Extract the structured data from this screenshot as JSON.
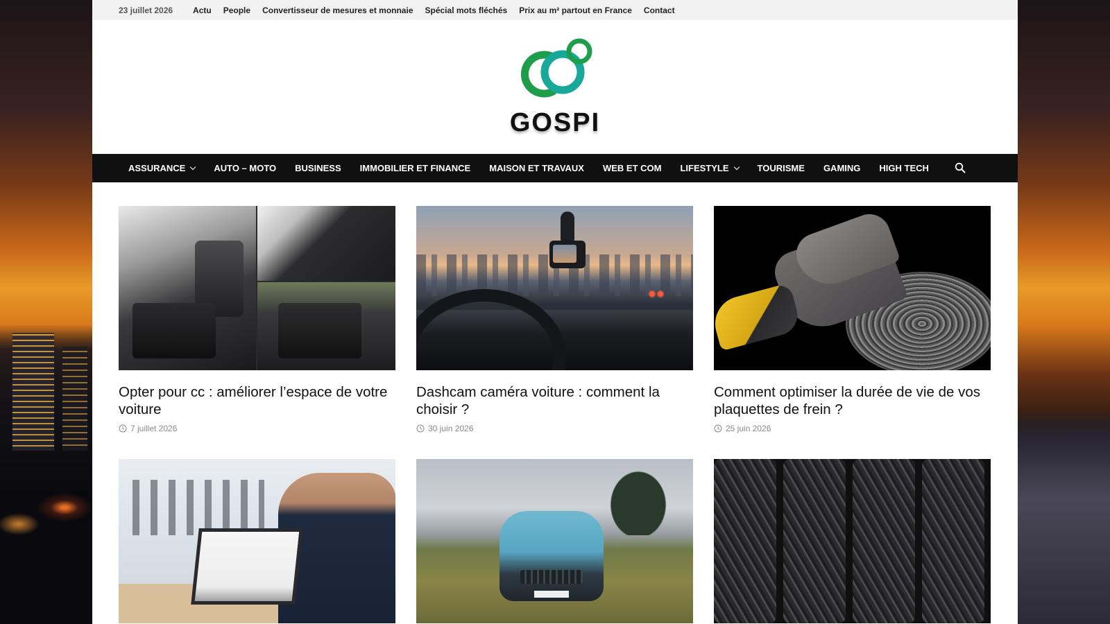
{
  "topbar": {
    "date": "23 juillet 2026",
    "links": [
      "Actu",
      "People",
      "Convertisseur de mesures et monnaie",
      "Spécial mots fléchés",
      "Prix au m² partout en France",
      "Contact"
    ]
  },
  "header": {
    "site_name": "GOSPI",
    "logo_icon": "interlocking-rings-logo",
    "colors": {
      "green": "#1e9e4a",
      "teal": "#18a89a"
    }
  },
  "mainnav": {
    "items": [
      {
        "label": "ASSURANCE",
        "has_dropdown": true
      },
      {
        "label": "AUTO – MOTO",
        "has_dropdown": false
      },
      {
        "label": "BUSINESS",
        "has_dropdown": false
      },
      {
        "label": "IMMOBILIER ET FINANCE",
        "has_dropdown": false
      },
      {
        "label": "MAISON ET TRAVAUX",
        "has_dropdown": false
      },
      {
        "label": "WEB ET COM",
        "has_dropdown": false
      },
      {
        "label": "LIFESTYLE",
        "has_dropdown": true
      },
      {
        "label": "TOURISME",
        "has_dropdown": false
      },
      {
        "label": "GAMING",
        "has_dropdown": false
      },
      {
        "label": "HIGH TECH",
        "has_dropdown": false
      }
    ],
    "search_icon": "search-icon"
  },
  "articles": [
    {
      "title": "Opter pour cc : améliorer l’espace de votre voiture",
      "date": "7 juillet 2026",
      "image": "car-interior-storage"
    },
    {
      "title": "Dashcam caméra voiture : comment la choisir ?",
      "date": "30 juin 2026",
      "image": "dashcam-on-windshield"
    },
    {
      "title": "Comment optimiser la durée de vie de vos plaquettes de frein ?",
      "date": "25 juin 2026",
      "image": "brake-pads-and-disc"
    },
    {
      "title": "",
      "date": "",
      "image": "man-using-laptop-office"
    },
    {
      "title": "",
      "date": "",
      "image": "blue-electric-car-on-grass"
    },
    {
      "title": "",
      "date": "",
      "image": "row-of-tires"
    }
  ]
}
